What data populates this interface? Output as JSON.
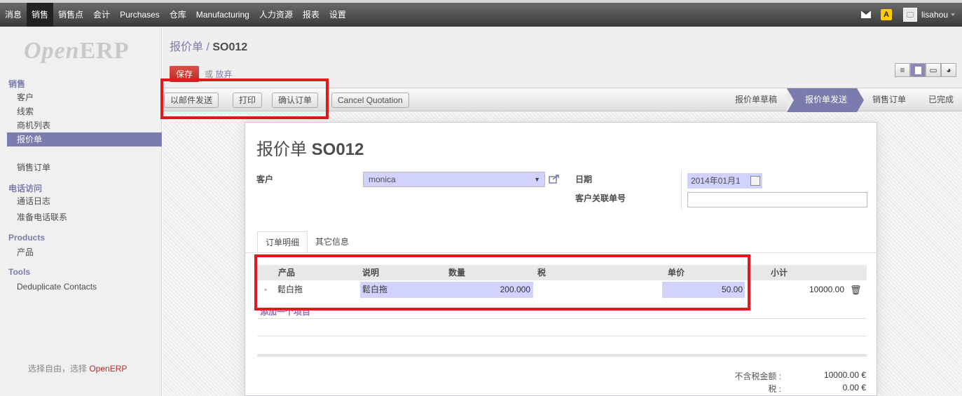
{
  "topbar": {
    "menu": [
      "消息",
      "销售",
      "销售点",
      "会计",
      "Purchases",
      "仓库",
      "Manufacturing",
      "人力资源",
      "报表",
      "设置"
    ],
    "alert_symbol": "A",
    "username": "lisahou"
  },
  "sidebar": {
    "logo_open": "Open",
    "logo_erp": "ERP",
    "sections": {
      "sales": "销售",
      "calls": "电话访问",
      "products": "Products",
      "tools": "Tools"
    },
    "items": {
      "customers": "客户",
      "leads": "线索",
      "opportunities": "商机列表",
      "quotations": "报价单",
      "sales_orders": "销售订单",
      "call_logs": "通话日志",
      "scheduled_calls": "准备电话联系",
      "product": "产品",
      "dedupe": "Deduplicate Contacts"
    },
    "footer_prefix": "选择自由，选择 ",
    "footer_brand": "OpenERP"
  },
  "header": {
    "breadcrumb_parent": "报价单",
    "breadcrumb_sep": " / ",
    "breadcrumb_current": "SO012",
    "save_label": "保存",
    "or_label": "或",
    "discard_label": "放弃"
  },
  "statusbar": {
    "buttons": [
      "以邮件发送",
      "打印",
      "确认订单",
      "Cancel Quotation"
    ],
    "steps": [
      "报价单草稿",
      "报价单发送",
      "销售订单",
      "已完成"
    ],
    "current_step_index": 1
  },
  "form": {
    "title_prefix": "报价单 ",
    "title_number": "SO012",
    "customer_label": "客户",
    "customer_value": "monica",
    "date_label": "日期",
    "date_value": "2014年01月1",
    "ref_label": "客户关联单号",
    "ref_value": "",
    "tabs": [
      "订单明细",
      "其它信息"
    ],
    "lines": {
      "headers": [
        "产品",
        "说明",
        "数量",
        "税",
        "单价",
        "小计"
      ],
      "rows": [
        {
          "product": "鬆白拖",
          "description": "鬆白拖",
          "qty": "200.000",
          "tax": "",
          "unit_price": "50.00",
          "subtotal": "10000.00"
        }
      ],
      "add_item": "添加一个项目"
    },
    "totals": {
      "untaxed_label": "不含税金额 :",
      "untaxed_value": "10000.00 €",
      "tax_label": "税 :",
      "tax_value": "0.00 €"
    }
  },
  "colors": {
    "accent": "#7c7bad",
    "save": "#b92c28",
    "editable_field": "#d2d2ff",
    "highlight_box": "#e0191f"
  }
}
